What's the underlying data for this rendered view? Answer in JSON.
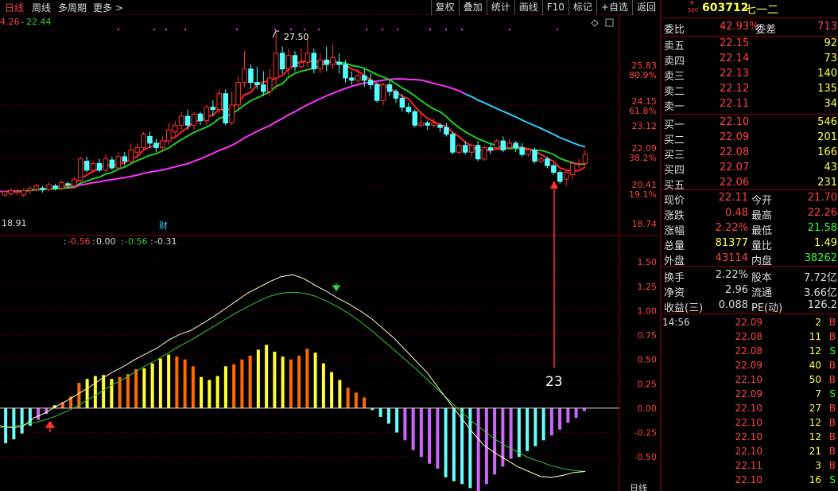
{
  "toolbar": {
    "left": [
      "日线",
      "周线",
      "多周期",
      "更多 >"
    ],
    "right": [
      "复权",
      "叠加",
      "统计",
      "画线",
      "F10",
      "标记",
      "+自选",
      "返回"
    ]
  },
  "main_panel": {
    "ma_label_left": "4.26",
    "ma_label_value": "22.44",
    "high_label": "27.50",
    "low_label": "18.91",
    "event_marker": "财",
    "price_axis": [
      "25.83",
      "80.9%",
      "24.15",
      "61.8%",
      "23.12",
      "22.09",
      "38.2%",
      "20.41",
      "19.1%",
      "18.74"
    ],
    "annotation": "23"
  },
  "macd_panel": {
    "values": [
      "-0.56",
      "0.00",
      "-0.56",
      "-0.31"
    ],
    "axis": [
      "1.50",
      "1.25",
      "1.00",
      "0.75",
      "0.50",
      "0.25",
      "0.00",
      "-0.25",
      "-0.50"
    ],
    "bottom_label": "日线"
  },
  "colors": {
    "up": "#ff3333",
    "down": "#54ffff",
    "ma_fast": "#ff2222",
    "ma_mid": "#22cc22",
    "ma_slow": "#ff33ff",
    "ma_slow_tail": "#33ccff",
    "macd_pos_a": "#ff6a00",
    "macd_pos_b": "#ffff33",
    "macd_neg_a": "#66ffff",
    "macd_neg_b": "#cc66ff",
    "dif": "#ffffcc",
    "dea": "#33cc33"
  },
  "stock": {
    "badge_top": "R",
    "badge_bottom": "500",
    "code": "603712",
    "name": "七一二"
  },
  "quote": {
    "weibi_label": "委比",
    "weibi_value": "42.93%",
    "weicha_label": "委差",
    "weicha_value": "713",
    "sell": [
      {
        "label": "卖五",
        "price": "22.15",
        "vol": "92"
      },
      {
        "label": "卖四",
        "price": "22.14",
        "vol": "73"
      },
      {
        "label": "卖三",
        "price": "22.13",
        "vol": "140"
      },
      {
        "label": "卖二",
        "price": "22.12",
        "vol": "135"
      },
      {
        "label": "卖一",
        "price": "22.11",
        "vol": "34"
      }
    ],
    "buy": [
      {
        "label": "买一",
        "price": "22.10",
        "vol": "546"
      },
      {
        "label": "买二",
        "price": "22.09",
        "vol": "201"
      },
      {
        "label": "买三",
        "price": "22.08",
        "vol": "166"
      },
      {
        "label": "买四",
        "price": "22.07",
        "vol": "43"
      },
      {
        "label": "买五",
        "price": "22.06",
        "vol": "231"
      }
    ],
    "stats": [
      {
        "l1": "现价",
        "v1": "22.11",
        "l2": "今开",
        "v2": "21.70"
      },
      {
        "l1": "涨跌",
        "v1": "0.48",
        "l2": "最高",
        "v2": "22.26"
      },
      {
        "l1": "涨幅",
        "v1": "2.22%",
        "l2": "最低",
        "v2": "21.58"
      },
      {
        "l1": "总量",
        "v1": "81377",
        "l2": "量比",
        "v2": "1.49"
      },
      {
        "l1": "外盘",
        "v1": "43114",
        "l2": "内盘",
        "v2": "38262"
      }
    ],
    "stats2": [
      {
        "l1": "换手",
        "v1": "2.22%",
        "l2": "股本",
        "v2": "7.72亿"
      },
      {
        "l1": "净资",
        "v1": "2.96",
        "l2": "流通",
        "v2": "3.66亿"
      },
      {
        "l1": "收益(三)",
        "v1": "0.088",
        "l2": "PE(动)",
        "v2": "126.2"
      }
    ]
  },
  "ticks": [
    {
      "time": "14:56",
      "price": "22.09",
      "vol": "2",
      "side": "B"
    },
    {
      "time": "",
      "price": "22.08",
      "vol": "11",
      "side": "B"
    },
    {
      "time": "",
      "price": "22.08",
      "vol": "12",
      "side": "S"
    },
    {
      "time": "",
      "price": "22.09",
      "vol": "40",
      "side": "B"
    },
    {
      "time": "",
      "price": "22.10",
      "vol": "50",
      "side": "B"
    },
    {
      "time": "",
      "price": "22.09",
      "vol": "7",
      "side": "S"
    },
    {
      "time": "",
      "price": "22.10",
      "vol": "27",
      "side": "B"
    },
    {
      "time": "",
      "price": "22.10",
      "vol": "12",
      "side": "B"
    },
    {
      "time": "",
      "price": "22.10",
      "vol": "12",
      "side": "B"
    },
    {
      "time": "",
      "price": "22.10",
      "vol": "21",
      "side": "B"
    },
    {
      "time": "",
      "price": "22.11",
      "vol": "3",
      "side": "B"
    },
    {
      "time": "",
      "price": "22.10",
      "vol": "16",
      "side": "S"
    }
  ],
  "chart_data": [
    {
      "type": "candlestick",
      "title": "",
      "ylim": [
        18.74,
        27.8
      ],
      "candles": [
        [
          20.3,
          20.45,
          20.2,
          20.5
        ],
        [
          20.35,
          20.5,
          20.25,
          20.6
        ],
        [
          20.4,
          20.45,
          20.3,
          20.55
        ],
        [
          20.3,
          20.5,
          20.2,
          20.6
        ],
        [
          20.5,
          20.6,
          20.35,
          20.7
        ],
        [
          20.55,
          20.7,
          20.45,
          20.8
        ],
        [
          20.6,
          20.55,
          20.4,
          20.7
        ],
        [
          20.55,
          20.75,
          20.45,
          20.85
        ],
        [
          20.7,
          20.6,
          20.5,
          20.8
        ],
        [
          20.6,
          20.85,
          20.5,
          20.95
        ],
        [
          20.8,
          20.75,
          20.6,
          20.9
        ],
        [
          20.7,
          21.0,
          20.55,
          21.1
        ],
        [
          20.95,
          21.9,
          20.85,
          22.0
        ],
        [
          21.8,
          21.4,
          21.3,
          22.0
        ],
        [
          21.4,
          21.7,
          21.3,
          21.8
        ],
        [
          21.7,
          21.4,
          21.3,
          21.9
        ],
        [
          21.4,
          21.9,
          21.3,
          22.1
        ],
        [
          21.85,
          21.5,
          21.4,
          22.0
        ],
        [
          21.5,
          22.0,
          21.4,
          22.2
        ],
        [
          22.0,
          21.8,
          21.6,
          22.2
        ],
        [
          21.8,
          22.3,
          21.7,
          22.6
        ],
        [
          22.2,
          22.4,
          22.0,
          22.6
        ],
        [
          22.4,
          23.0,
          22.3,
          23.1
        ],
        [
          22.9,
          22.6,
          22.4,
          23.1
        ],
        [
          22.6,
          22.4,
          22.2,
          22.8
        ],
        [
          22.4,
          22.7,
          22.2,
          22.9
        ],
        [
          22.7,
          23.2,
          22.5,
          23.5
        ],
        [
          23.1,
          23.4,
          22.9,
          23.6
        ],
        [
          23.4,
          23.8,
          23.2,
          24.0
        ],
        [
          23.8,
          23.4,
          23.2,
          24.1
        ],
        [
          23.4,
          23.9,
          23.2,
          24.0
        ],
        [
          23.9,
          23.6,
          23.4,
          24.0
        ],
        [
          23.6,
          24.2,
          23.4,
          24.3
        ],
        [
          24.2,
          24.1,
          23.8,
          24.5
        ],
        [
          24.1,
          24.8,
          23.9,
          25.0
        ],
        [
          24.8,
          23.5,
          23.4,
          25.0
        ],
        [
          23.5,
          24.3,
          23.4,
          24.9
        ],
        [
          24.3,
          25.3,
          24.1,
          25.6
        ],
        [
          25.3,
          25.9,
          25.1,
          26.7
        ],
        [
          25.9,
          25.3,
          25.0,
          26.1
        ],
        [
          25.3,
          25.2,
          25.0,
          26.0
        ],
        [
          25.2,
          24.9,
          24.7,
          25.8
        ],
        [
          24.9,
          25.5,
          24.7,
          25.9
        ],
        [
          25.5,
          26.6,
          25.0,
          27.5
        ],
        [
          26.6,
          25.9,
          25.7,
          26.9
        ],
        [
          25.9,
          26.5,
          25.6,
          26.8
        ],
        [
          26.5,
          26.0,
          25.8,
          26.7
        ],
        [
          26.0,
          26.2,
          25.9,
          26.8
        ],
        [
          26.2,
          26.6,
          26.0,
          27.2
        ],
        [
          26.6,
          25.9,
          25.7,
          26.8
        ],
        [
          25.9,
          26.3,
          25.7,
          26.6
        ],
        [
          26.3,
          26.1,
          25.8,
          26.9
        ],
        [
          26.1,
          26.4,
          25.9,
          27.0
        ],
        [
          26.2,
          26.1,
          25.7,
          26.6
        ],
        [
          26.1,
          25.5,
          25.3,
          26.3
        ],
        [
          25.5,
          25.4,
          25.2,
          25.8
        ],
        [
          25.4,
          25.6,
          25.2,
          25.9
        ],
        [
          25.6,
          25.4,
          25.1,
          25.9
        ],
        [
          25.4,
          25.2,
          25.0,
          25.7
        ],
        [
          25.2,
          24.5,
          24.4,
          25.3
        ],
        [
          24.5,
          25.2,
          24.3,
          25.3
        ],
        [
          25.2,
          24.9,
          24.7,
          25.4
        ],
        [
          24.9,
          24.6,
          24.4,
          25.0
        ],
        [
          24.6,
          24.2,
          24.0,
          24.8
        ],
        [
          24.2,
          24.0,
          23.9,
          24.4
        ],
        [
          24.0,
          23.4,
          23.3,
          24.1
        ],
        [
          23.4,
          23.5,
          23.3,
          23.9
        ],
        [
          23.5,
          23.4,
          23.2,
          23.6
        ],
        [
          23.4,
          23.5,
          23.3,
          23.7
        ],
        [
          23.4,
          23.3,
          23.1,
          23.5
        ],
        [
          23.3,
          23.0,
          22.9,
          23.5
        ],
        [
          23.0,
          22.2,
          22.1,
          23.1
        ],
        [
          22.2,
          22.5,
          22.1,
          22.6
        ],
        [
          22.5,
          22.2,
          22.1,
          22.7
        ],
        [
          22.2,
          22.5,
          22.0,
          22.6
        ],
        [
          22.5,
          21.9,
          21.8,
          22.7
        ],
        [
          21.9,
          22.4,
          21.8,
          22.5
        ],
        [
          22.4,
          22.3,
          22.1,
          22.6
        ],
        [
          22.4,
          22.7,
          22.3,
          22.8
        ],
        [
          22.7,
          22.3,
          22.2,
          22.9
        ],
        [
          22.4,
          22.6,
          22.3,
          22.8
        ],
        [
          22.6,
          22.4,
          22.2,
          22.7
        ],
        [
          22.4,
          22.1,
          22.0,
          22.6
        ],
        [
          22.1,
          22.3,
          22.0,
          22.4
        ],
        [
          22.3,
          21.8,
          21.7,
          22.4
        ],
        [
          21.8,
          21.9,
          21.7,
          22.0
        ],
        [
          21.9,
          21.6,
          21.5,
          22.0
        ],
        [
          21.6,
          21.3,
          21.2,
          21.7
        ],
        [
          21.3,
          20.9,
          20.8,
          21.4
        ],
        [
          21.0,
          21.3,
          20.7,
          21.4
        ],
        [
          21.2,
          21.7,
          21.0,
          21.8
        ],
        [
          21.7,
          21.7,
          21.5,
          21.9
        ],
        [
          21.7,
          22.1,
          21.6,
          22.3
        ]
      ]
    },
    {
      "type": "bar",
      "title": "MACD",
      "ylim": [
        -0.85,
        1.6
      ],
      "values": [
        -0.36,
        -0.32,
        -0.26,
        -0.18,
        -0.12,
        -0.06,
        0.03,
        0.06,
        0.12,
        0.26,
        0.3,
        0.33,
        0.34,
        0.3,
        0.32,
        0.35,
        0.4,
        0.41,
        0.46,
        0.51,
        0.55,
        0.53,
        0.5,
        0.43,
        0.32,
        0.29,
        0.33,
        0.43,
        0.45,
        0.5,
        0.54,
        0.6,
        0.65,
        0.58,
        0.53,
        0.5,
        0.54,
        0.61,
        0.57,
        0.46,
        0.37,
        0.29,
        0.21,
        0.16,
        0.11,
        -0.02,
        -0.09,
        -0.16,
        -0.25,
        -0.33,
        -0.43,
        -0.5,
        -0.57,
        -0.62,
        -0.71,
        -0.75,
        -0.78,
        -0.82,
        -0.85,
        -0.78,
        -0.68,
        -0.6,
        -0.52,
        -0.5,
        -0.44,
        -0.39,
        -0.33,
        -0.28,
        -0.22,
        -0.15,
        -0.1,
        -0.03
      ],
      "dif": [
        -0.18,
        -0.2,
        -0.19,
        -0.1,
        -0.05,
        0.02,
        0.08,
        0.15,
        0.22,
        0.3,
        0.37,
        0.43,
        0.5,
        0.56,
        0.62,
        0.7,
        0.76,
        0.8,
        0.87,
        0.94,
        1.02,
        1.1,
        1.18,
        1.24,
        1.3,
        1.35,
        1.37,
        1.33,
        1.26,
        1.2,
        1.13,
        1.07,
        1.0,
        0.92,
        0.82,
        0.72,
        0.6,
        0.48,
        0.36,
        0.2,
        0.05,
        -0.1,
        -0.25,
        -0.38,
        -0.46,
        -0.53,
        -0.6,
        -0.65,
        -0.7,
        -0.71,
        -0.69,
        -0.66,
        -0.65
      ],
      "dea": [
        -0.2,
        -0.19,
        -0.17,
        -0.15,
        -0.12,
        -0.08,
        -0.03,
        0.03,
        0.1,
        0.17,
        0.24,
        0.3,
        0.37,
        0.44,
        0.5,
        0.57,
        0.64,
        0.7,
        0.77,
        0.84,
        0.91,
        0.98,
        1.04,
        1.1,
        1.15,
        1.18,
        1.19,
        1.18,
        1.15,
        1.1,
        1.04,
        0.97,
        0.89,
        0.8,
        0.7,
        0.6,
        0.5,
        0.4,
        0.29,
        0.18,
        0.07,
        -0.04,
        -0.14,
        -0.23,
        -0.32,
        -0.39,
        -0.45,
        -0.51,
        -0.55,
        -0.59,
        -0.62,
        -0.64,
        -0.65
      ]
    }
  ]
}
